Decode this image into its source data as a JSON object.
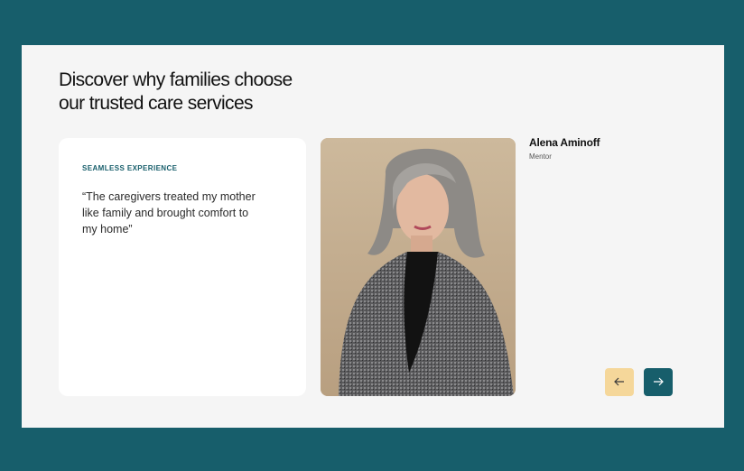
{
  "section": {
    "heading": "Discover why families choose\nour trusted care services"
  },
  "testimonial": {
    "eyebrow": "SEAMLESS EXPERIENCE",
    "quote": "“The caregivers treated my mother like family and brought comfort to my home”",
    "person_name": "Alena Aminoff",
    "person_role": "Mentor"
  },
  "navigation": {
    "prev_icon": "arrow-left-icon",
    "next_icon": "arrow-right-icon"
  },
  "colors": {
    "outer_background": "#175e6b",
    "panel_background": "#f5f5f5",
    "accent_teal": "#175e6b",
    "accent_yellow": "#f5d79a"
  }
}
